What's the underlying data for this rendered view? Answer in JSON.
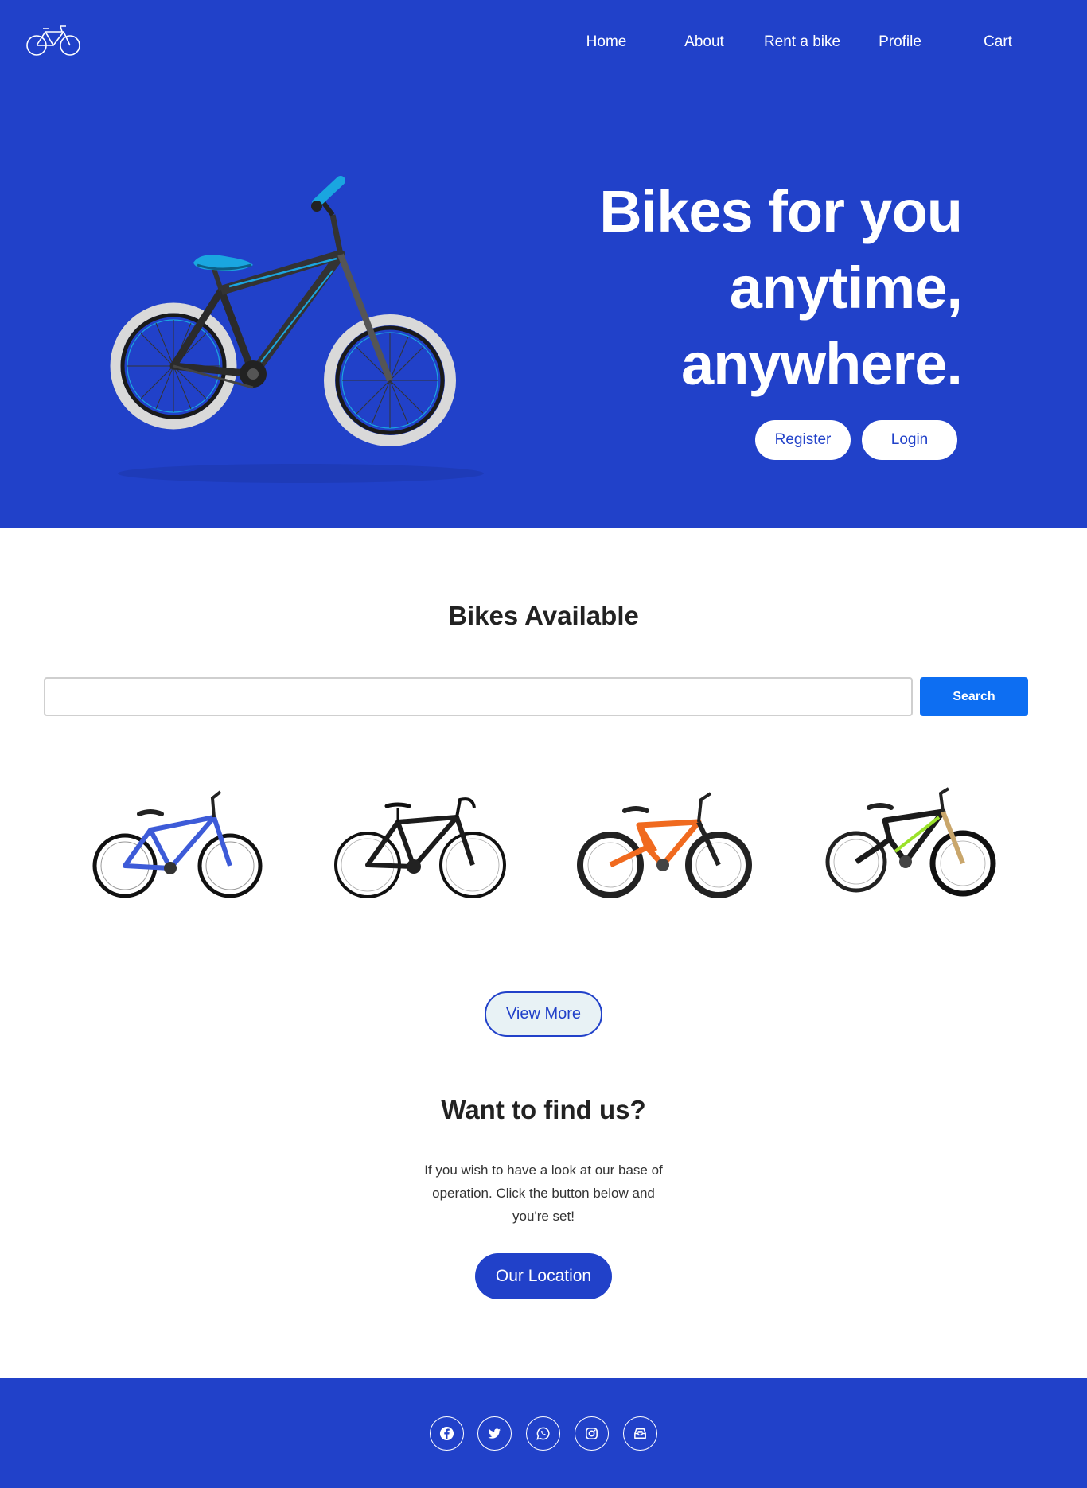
{
  "nav": {
    "logo_icon": "bicycle-icon",
    "items": [
      "Home",
      "About",
      "Rent a bike",
      "Profile",
      "Cart"
    ]
  },
  "hero": {
    "title_lines": [
      "Bikes for you",
      "anytime,",
      "anywhere."
    ],
    "register_label": "Register",
    "login_label": "Login"
  },
  "bikes_section": {
    "title": "Bikes Available",
    "search": {
      "value": "",
      "placeholder": ""
    },
    "search_label": "Search",
    "bikes": [
      {
        "name": "blue-kids-bike-image",
        "color": "#3d5bd8"
      },
      {
        "name": "black-road-bike-image",
        "color": "#1c1c1c"
      },
      {
        "name": "orange-mountain-bike-image",
        "color": "#f06a1f"
      },
      {
        "name": "green-mountain-bike-image",
        "color": "#9be22a"
      }
    ],
    "view_more_label": "View More"
  },
  "find_section": {
    "title": "Want to find us?",
    "text": "If you wish to have a look at our base of operation. Click the button below and you're set!",
    "location_label": "Our Location"
  },
  "footer": {
    "social_icons": [
      "facebook-icon",
      "twitter-icon",
      "whatsapp-icon",
      "instagram-icon",
      "mail-inbox-icon"
    ]
  },
  "colors": {
    "brand_blue": "#2141c9",
    "search_blue": "#0d6ef2",
    "view_more_bg": "#e8f2f5"
  }
}
